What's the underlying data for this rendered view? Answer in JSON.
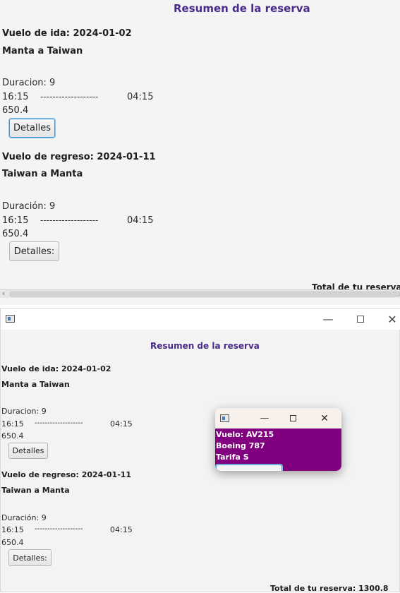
{
  "top_panel": {
    "title": "Resumen de la reserva",
    "outbound": {
      "header": "Vuelo de ida: 2024-01-02",
      "route": "Manta a Taiwan",
      "duration": "Duracion: 9",
      "depart_time": "16:15",
      "dashes": "-------------------",
      "arrive_time": "04:15",
      "price": "650.4",
      "details_button": "Detalles"
    },
    "return": {
      "header": "Vuelo de regreso: 2024-01-11",
      "route": "Taiwan a Manta",
      "duration": "Duración: 9",
      "depart_time": "16:15",
      "dashes": "-------------------",
      "arrive_time": "04:15",
      "price": "650.4",
      "details_button": "Detalles:"
    },
    "total_partial": "Total de tu reserva:"
  },
  "main_window": {
    "icons": {
      "app": "app-window-icon",
      "minimize": "minimize-icon",
      "maximize": "maximize-icon",
      "close": "close-icon"
    },
    "title": "Resumen de la reserva",
    "outbound": {
      "header": "Vuelo de ida: 2024-01-02",
      "route": "Manta a Taiwan",
      "duration": "Duracion: 9",
      "depart_time": "16:15",
      "dashes": "-------------------",
      "arrive_time": "04:15",
      "price": "650.4",
      "details_button": "Detalles"
    },
    "return": {
      "header": "Vuelo de regreso: 2024-01-11",
      "route": "Taiwan a Manta",
      "duration": "Duración: 9",
      "depart_time": "16:15",
      "dashes": "-------------------",
      "arrive_time": "04:15",
      "price": "650.4",
      "details_button": "Detalles:"
    },
    "total": "Total de tu reserva: 1300.8"
  },
  "popup": {
    "icons": {
      "app": "app-window-icon",
      "minimize": "minimize-icon",
      "maximize": "maximize-icon",
      "close": "close-icon"
    },
    "flight": "Vuelo: AV215",
    "aircraft": "Boeing 787",
    "fare": "Tarifa S"
  },
  "colors": {
    "title": "#4a2a8a",
    "popup_body": "#800080",
    "button_focus": "#3b9ad6"
  }
}
